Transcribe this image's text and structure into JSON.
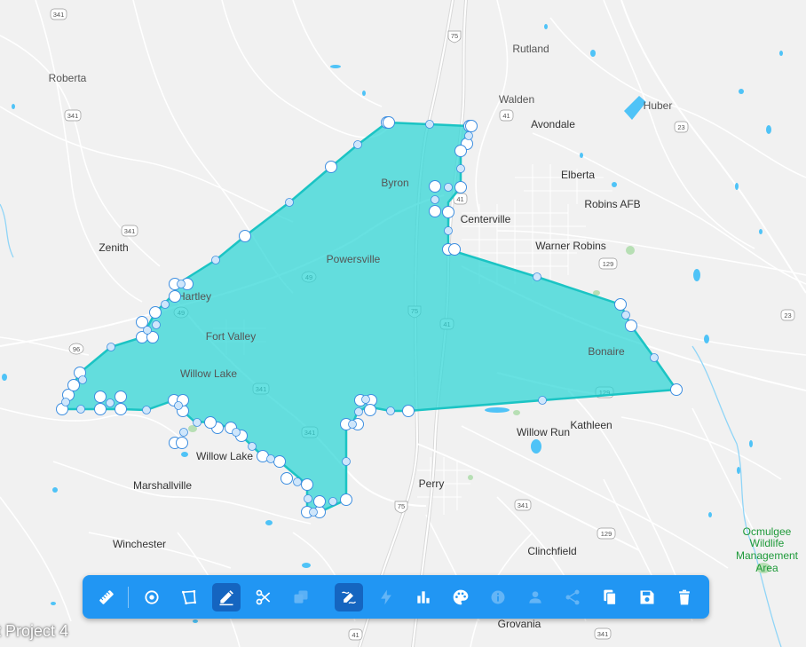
{
  "project": {
    "name": "t Project 4"
  },
  "places": {
    "rutland": "Rutland",
    "roberta": "Roberta",
    "walden": "Walden",
    "avondale": "Avondale",
    "huber": "Huber",
    "byron": "Byron",
    "elberta": "Elberta",
    "robins_afb": "Robins AFB",
    "centerville": "Centerville",
    "warner_robins": "Warner Robins",
    "zenith": "Zenith",
    "powersville": "Powersville",
    "hartley": "Hartley",
    "fort_valley": "Fort Valley",
    "bonaire": "Bonaire",
    "willow_lake_1": "Willow Lake",
    "willow_run": "Willow Run",
    "kathleen": "Kathleen",
    "willow_lake_2": "Willow Lake",
    "marshallville": "Marshallville",
    "perry": "Perry",
    "winchester": "Winchester",
    "clinchfield": "Clinchfield",
    "grovania": "Grovania"
  },
  "park": {
    "line1": "Ocmulgee",
    "line2": "Wildlife",
    "line3": "Management",
    "line4": "Area"
  },
  "shields": {
    "us341_top": "341",
    "us341_a": "341",
    "us341_b": "341",
    "us341_c": "341",
    "us341_d": "341",
    "us341_e": "341",
    "us341_f": "341",
    "us41_a": "41",
    "us41_b": "41",
    "us41_c": "41",
    "us41_d": "41",
    "i75_a": "75",
    "i75_b": "75",
    "i75_c": "75",
    "sr49_a": "49",
    "sr49_b": "49",
    "us129_a": "129",
    "us129_b": "129",
    "us129_c": "129",
    "us23_a": "23",
    "us23_b": "23",
    "sr96": "96",
    "sr247": "247"
  },
  "toolbar": {
    "tools": [
      {
        "name": "measure",
        "icon": "ruler-icon",
        "active": false,
        "enabled": true
      },
      {
        "name": "draw-point",
        "icon": "target-icon",
        "active": false,
        "enabled": true
      },
      {
        "name": "draw-polygon",
        "icon": "polygon-icon",
        "active": false,
        "enabled": true
      },
      {
        "name": "edit",
        "icon": "edit-icon",
        "active": true,
        "enabled": true
      },
      {
        "name": "cut",
        "icon": "scissors-icon",
        "active": false,
        "enabled": true
      },
      {
        "name": "merge",
        "icon": "merge-icon",
        "active": false,
        "enabled": false
      },
      {
        "name": "simplify",
        "icon": "simplify-icon",
        "active": true,
        "enabled": true
      },
      {
        "name": "flash",
        "icon": "lightning-icon",
        "active": false,
        "enabled": false
      },
      {
        "name": "stats",
        "icon": "bar-chart-icon",
        "active": false,
        "enabled": true
      },
      {
        "name": "style",
        "icon": "palette-icon",
        "active": false,
        "enabled": true
      },
      {
        "name": "info",
        "icon": "info-icon",
        "active": false,
        "enabled": false
      },
      {
        "name": "people",
        "icon": "person-icon",
        "active": false,
        "enabled": false
      },
      {
        "name": "share",
        "icon": "share-icon",
        "active": false,
        "enabled": false
      },
      {
        "name": "copy",
        "icon": "copy-icon",
        "active": false,
        "enabled": true
      },
      {
        "name": "save",
        "icon": "save-icon",
        "active": false,
        "enabled": true
      },
      {
        "name": "delete",
        "icon": "trash-icon",
        "active": false,
        "enabled": true
      }
    ]
  },
  "colors": {
    "map_bg": "#f1f1f1",
    "road": "#ffffff",
    "road_major": "#dcdcdc",
    "water": "#4fc3f7",
    "polygon_fill": "#2dd6d6",
    "polygon_stroke": "#1bc4c4",
    "vertex_fill": "#ffffff",
    "vertex_stroke": "#3d8ee0",
    "midpoint_fill": "#cfe6fb",
    "toolbar_bg": "#2196f3",
    "toolbar_active": "#1565c0",
    "park_text": "#1f9a3a"
  }
}
